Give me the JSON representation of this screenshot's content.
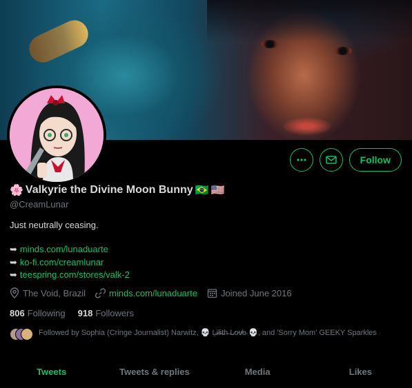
{
  "profile": {
    "flower_emoji": "🌸",
    "display_name": "Valkyrie the Divine Moon Bunny",
    "flag1": "🇧🇷",
    "flag2": "🇺🇸",
    "handle": "@CreamLunar",
    "bio": "Just neutrally ceasing.",
    "bio_arrow": "➥",
    "bio_links": [
      "minds.com/lunaduarte",
      "ko-fi.com/creamlunar",
      "teespring.com/stores/valk-2"
    ],
    "location": "The Void, Brazil",
    "website": "minds.com/lunaduarte",
    "joined": "Joined June 2016",
    "following_count": "806",
    "following_label": "Following",
    "followers_count": "918",
    "followers_label": "Followers",
    "followed_by": "Followed by Sophia (Cringe Journalist) Narwitz, 💀 Ḻ̴i̷l̵i̴t̶h̵ ̶L̷o̷v̸e̵ 💀, and 'Sorry Mom' GEEKY Sparkles"
  },
  "actions": {
    "more_icon": "ellipsis-icon",
    "message_icon": "envelope-icon",
    "follow_label": "Follow"
  },
  "tabs": [
    {
      "label": "Tweets",
      "active": true
    },
    {
      "label": "Tweets & replies",
      "active": false
    },
    {
      "label": "Media",
      "active": false
    },
    {
      "label": "Likes",
      "active": false
    }
  ],
  "colors": {
    "accent": "#17bf63",
    "background": "#000000",
    "text": "#d9d9d9",
    "muted": "#6e767d"
  }
}
